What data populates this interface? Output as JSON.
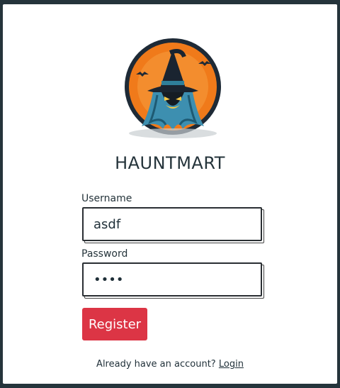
{
  "brand": {
    "name": "HAUNTMART",
    "logo_icon": "witch-jack-o-lantern-logo"
  },
  "form": {
    "username_label": "Username",
    "username_value": "asdf",
    "password_label": "Password",
    "password_value": "asdf",
    "register_label": "Register"
  },
  "footer": {
    "prompt": "Already have an account?",
    "login_link": "Login"
  },
  "colors": {
    "background": "#25343b",
    "accent": "#dc3545",
    "logo_orange": "#f07a1a"
  }
}
